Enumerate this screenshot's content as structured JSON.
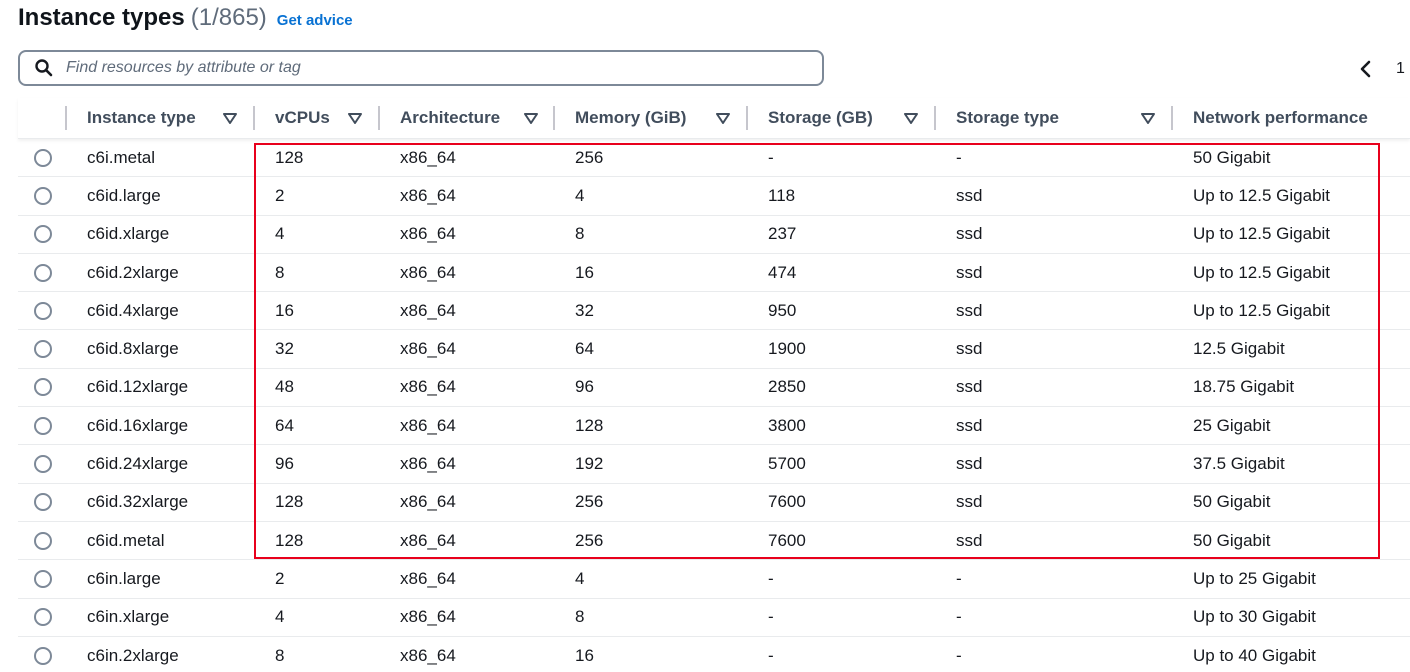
{
  "header": {
    "title": "Instance types",
    "count": "(1/865)",
    "advice_link": "Get advice"
  },
  "search": {
    "placeholder": "Find resources by attribute or tag",
    "value": ""
  },
  "pagination": {
    "current_page": "1"
  },
  "table": {
    "columns": [
      "Instance type",
      "vCPUs",
      "Architecture",
      "Memory (GiB)",
      "Storage (GB)",
      "Storage type",
      "Network performance"
    ],
    "rows": [
      [
        "c6i.metal",
        "128",
        "x86_64",
        "256",
        "-",
        "-",
        "50 Gigabit"
      ],
      [
        "c6id.large",
        "2",
        "x86_64",
        "4",
        "118",
        "ssd",
        "Up to 12.5 Gigabit"
      ],
      [
        "c6id.xlarge",
        "4",
        "x86_64",
        "8",
        "237",
        "ssd",
        "Up to 12.5 Gigabit"
      ],
      [
        "c6id.2xlarge",
        "8",
        "x86_64",
        "16",
        "474",
        "ssd",
        "Up to 12.5 Gigabit"
      ],
      [
        "c6id.4xlarge",
        "16",
        "x86_64",
        "32",
        "950",
        "ssd",
        "Up to 12.5 Gigabit"
      ],
      [
        "c6id.8xlarge",
        "32",
        "x86_64",
        "64",
        "1900",
        "ssd",
        "12.5 Gigabit"
      ],
      [
        "c6id.12xlarge",
        "48",
        "x86_64",
        "96",
        "2850",
        "ssd",
        "18.75 Gigabit"
      ],
      [
        "c6id.16xlarge",
        "64",
        "x86_64",
        "128",
        "3800",
        "ssd",
        "25 Gigabit"
      ],
      [
        "c6id.24xlarge",
        "96",
        "x86_64",
        "192",
        "5700",
        "ssd",
        "37.5 Gigabit"
      ],
      [
        "c6id.32xlarge",
        "128",
        "x86_64",
        "256",
        "7600",
        "ssd",
        "50 Gigabit"
      ],
      [
        "c6id.metal",
        "128",
        "x86_64",
        "256",
        "7600",
        "ssd",
        "50 Gigabit"
      ],
      [
        "c6in.large",
        "2",
        "x86_64",
        "4",
        "-",
        "-",
        "Up to 25 Gigabit"
      ],
      [
        "c6in.xlarge",
        "4",
        "x86_64",
        "8",
        "-",
        "-",
        "Up to 30 Gigabit"
      ],
      [
        "c6in.2xlarge",
        "8",
        "x86_64",
        "16",
        "-",
        "-",
        "Up to 40 Gigabit"
      ]
    ]
  },
  "icons": {
    "search": "search-icon",
    "prev_page": "chevron-left-icon",
    "sort": "caret-down-icon",
    "radio": "radio-button"
  },
  "colors": {
    "link": "#0972d3",
    "highlight_box": "#e8001c",
    "header_text": "#414d5c"
  }
}
